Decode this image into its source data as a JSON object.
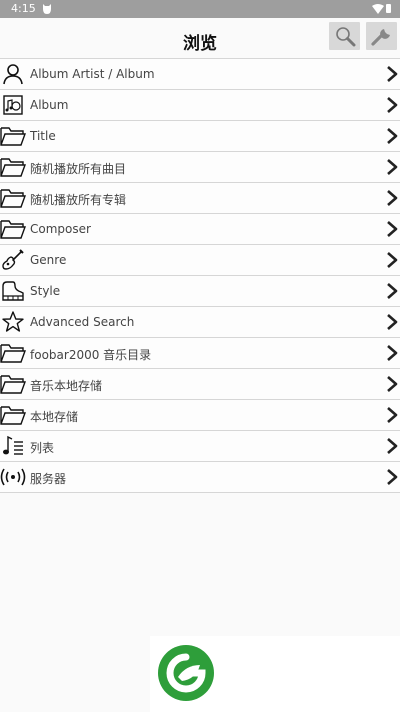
{
  "status_bar": {
    "time": "4:15"
  },
  "toolbar": {
    "title": "浏览",
    "search_icon": "search-icon",
    "settings_icon": "wrench-icon"
  },
  "browse_items": [
    {
      "label": "Album Artist / Album",
      "icon": "person-icon"
    },
    {
      "label": "Album",
      "icon": "album-icon"
    },
    {
      "label": "Title",
      "icon": "folder-icon"
    },
    {
      "label": "随机播放所有曲目",
      "icon": "folder-icon"
    },
    {
      "label": "随机播放所有专辑",
      "icon": "folder-icon"
    },
    {
      "label": "Composer",
      "icon": "folder-icon"
    },
    {
      "label": "Genre",
      "icon": "guitar-icon"
    },
    {
      "label": "Style",
      "icon": "piano-icon"
    },
    {
      "label": "Advanced Search",
      "icon": "star-icon"
    },
    {
      "label": "foobar2000 音乐目录",
      "icon": "folder-icon"
    },
    {
      "label": "音乐本地存储",
      "icon": "folder-icon"
    },
    {
      "label": "本地存储",
      "icon": "folder-icon"
    },
    {
      "label": "列表",
      "icon": "playlist-icon"
    },
    {
      "label": "服务器",
      "icon": "broadcast-icon"
    }
  ],
  "colors": {
    "status_bar": "#9e9e9e",
    "button_bg": "#d8d8d8",
    "divider": "#d6d6d6",
    "ad_logo": "#2e9e3a"
  }
}
